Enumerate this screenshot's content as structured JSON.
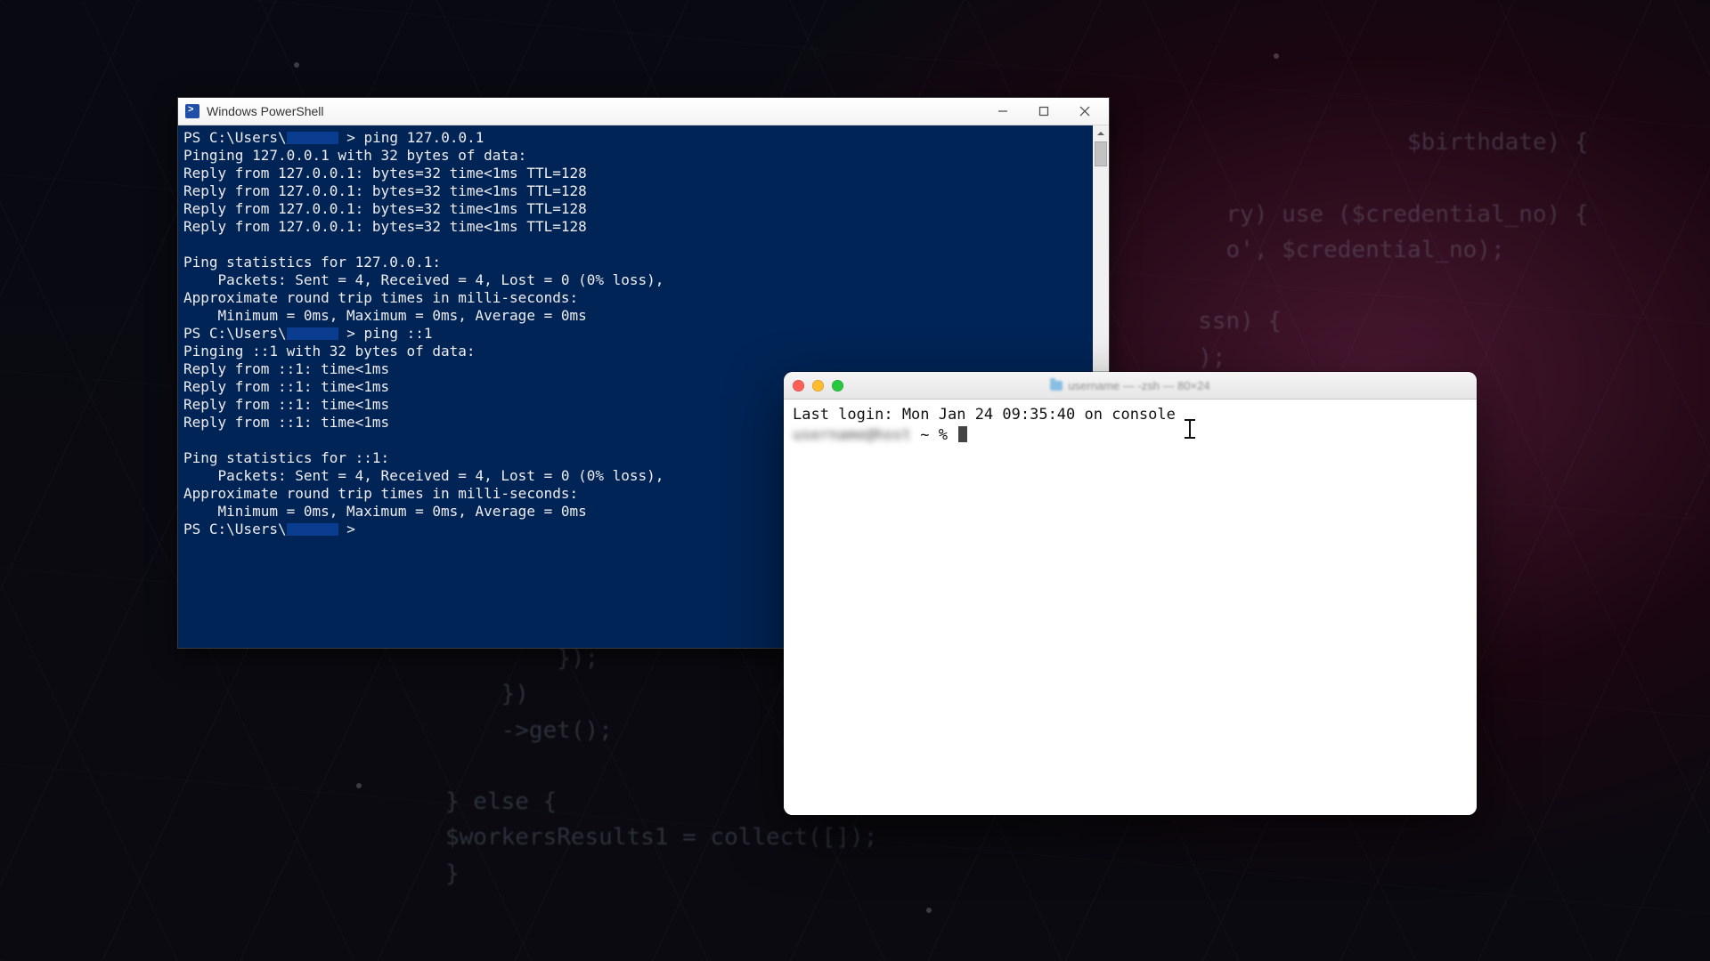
{
  "background_code": {
    "block_a": "                       $birthdate) {\n\n          ry) use ($credential_no) {\n          o', $credential_no);\n\n        ssn) {\n        );",
    "block_b": "        });\n    })\n    ->get();\n\n} else {\n$workersResults1 = collect([]);\n}"
  },
  "powershell": {
    "title": "Windows PowerShell",
    "prompt_path": "PS C:\\Users\\",
    "cmd1": "ping 127.0.0.1",
    "line_pinging1": "Pinging 127.0.0.1 with 32 bytes of data:",
    "reply_v4": "Reply from 127.0.0.1: bytes=32 time<1ms TTL=128",
    "stats_hdr1": "Ping statistics for 127.0.0.1:",
    "stats_pkts": "    Packets: Sent = 4, Received = 4, Lost = 0 (0% loss),",
    "rtt_hdr": "Approximate round trip times in milli-seconds:",
    "rtt_vals": "    Minimum = 0ms, Maximum = 0ms, Average = 0ms",
    "cmd2": "ping ::1",
    "line_pinging2": "Pinging ::1 with 32 bytes of data:",
    "reply_v6": "Reply from ::1: time<1ms",
    "stats_hdr2": "Ping statistics for ::1:"
  },
  "mac_terminal": {
    "title_blurred": "username — -zsh — 80×24",
    "last_login": "Last login: Mon Jan 24 09:35:40 on console",
    "prompt_user_blurred": "username@host",
    "prompt_tail": " ~ % "
  }
}
